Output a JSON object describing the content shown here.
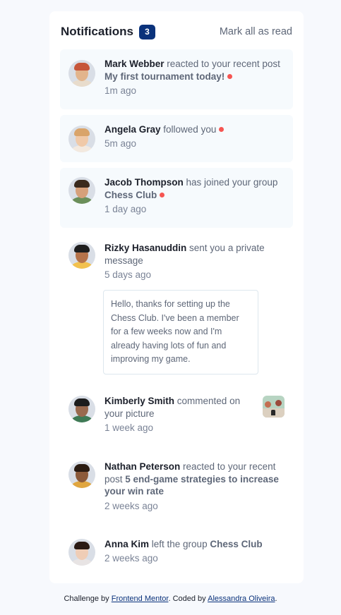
{
  "header": {
    "title": "Notifications",
    "unread_count": "3",
    "mark_all_label": "Mark all as read"
  },
  "notifications": [
    {
      "name": "Mark Webber",
      "action": " reacted to your recent post ",
      "target": "My first tournament today!",
      "time": "1m ago",
      "unread": true,
      "avatar": {
        "skin": "#e2b48c",
        "hair": "#c6563a",
        "body": "#e8dccc"
      }
    },
    {
      "name": "Angela Gray",
      "action": " followed you",
      "target": "",
      "time": "5m ago",
      "unread": true,
      "avatar": {
        "skin": "#f0c9a8",
        "hair": "#d9a46a",
        "body": "#f3e9df"
      }
    },
    {
      "name": "Jacob Thompson",
      "action": " has joined your group ",
      "target": "Chess Club",
      "time": "1 day ago",
      "unread": true,
      "avatar": {
        "skin": "#d6a07a",
        "hair": "#3a2a1d",
        "body": "#6b8f5a"
      }
    },
    {
      "name": "Rizky Hasanuddin",
      "action": " sent you a private message",
      "target": "",
      "time": "5 days ago",
      "unread": false,
      "message": "Hello, thanks for setting up the Chess Club. I've been a member for a few weeks now and I'm already having lots of fun and improving my game.",
      "avatar": {
        "skin": "#b5734a",
        "hair": "#1e1e1e",
        "body": "#f2c14e"
      }
    },
    {
      "name": "Kimberly Smith",
      "action": " commented on your picture",
      "target": "",
      "time": "1 week ago",
      "unread": false,
      "avatar": {
        "skin": "#9a6a4e",
        "hair": "#1d1d1d",
        "body": "#3f7a55"
      }
    },
    {
      "name": "Nathan Peterson",
      "action": " reacted to your recent post ",
      "target": "5 end-game strategies to increase your win rate",
      "time": "2 weeks ago",
      "unread": false,
      "avatar": {
        "skin": "#8c5a3a",
        "hair": "#2b1c12",
        "body": "#e0a640"
      }
    },
    {
      "name": "Anna Kim",
      "action": " left the group ",
      "target": "Chess Club",
      "time": "2 weeks ago",
      "unread": false,
      "avatar": {
        "skin": "#efcdb6",
        "hair": "#2a1a14",
        "body": "#e8e4e4"
      }
    }
  ],
  "footer": {
    "prefix": "Challenge by ",
    "mentor_link": "Frontend Mentor",
    "middle": ". Coded by ",
    "author_link": "Alessandra Oliveira",
    "suffix": "."
  },
  "colors": {
    "accent": "#0a327b",
    "unread_dot": "#f65552",
    "unread_bg": "#f6fafd",
    "background": "#f7f9fd"
  }
}
